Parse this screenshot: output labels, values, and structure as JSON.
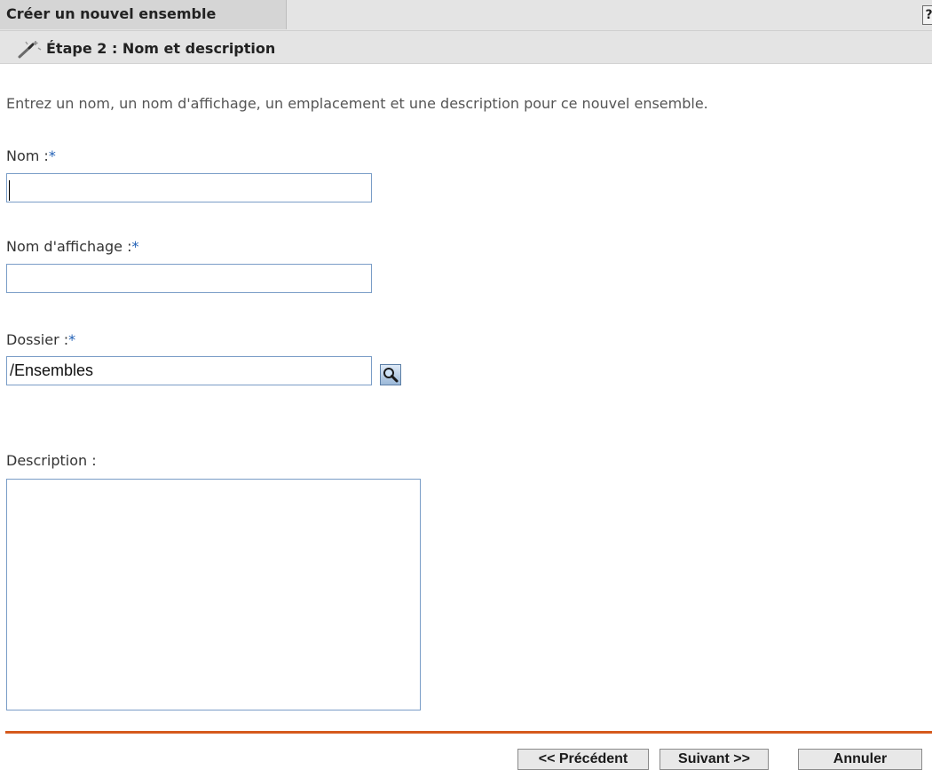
{
  "header": {
    "title": "Créer un nouvel ensemble",
    "help_label": "?"
  },
  "step": {
    "icon": "wand-icon",
    "title": "Étape 2 : Nom et description"
  },
  "intro": "Entrez un nom, un nom d'affichage, un emplacement et une description pour ce nouvel ensemble.",
  "form": {
    "name": {
      "label": "Nom :",
      "required_mark": "*",
      "value": ""
    },
    "display_name": {
      "label": "Nom d'affichage :",
      "required_mark": "*",
      "value": ""
    },
    "folder": {
      "label": "Dossier :",
      "required_mark": "*",
      "value": "/Ensembles",
      "browse_icon": "magnifier-icon"
    },
    "description": {
      "label": "Description :",
      "value": ""
    }
  },
  "buttons": {
    "previous": "<< Précédent",
    "next": "Suivant >>",
    "cancel": "Annuler"
  },
  "colors": {
    "accent_divider": "#d55a1d",
    "required_marker": "#1f5fb5",
    "input_border": "#7a9dc7"
  }
}
